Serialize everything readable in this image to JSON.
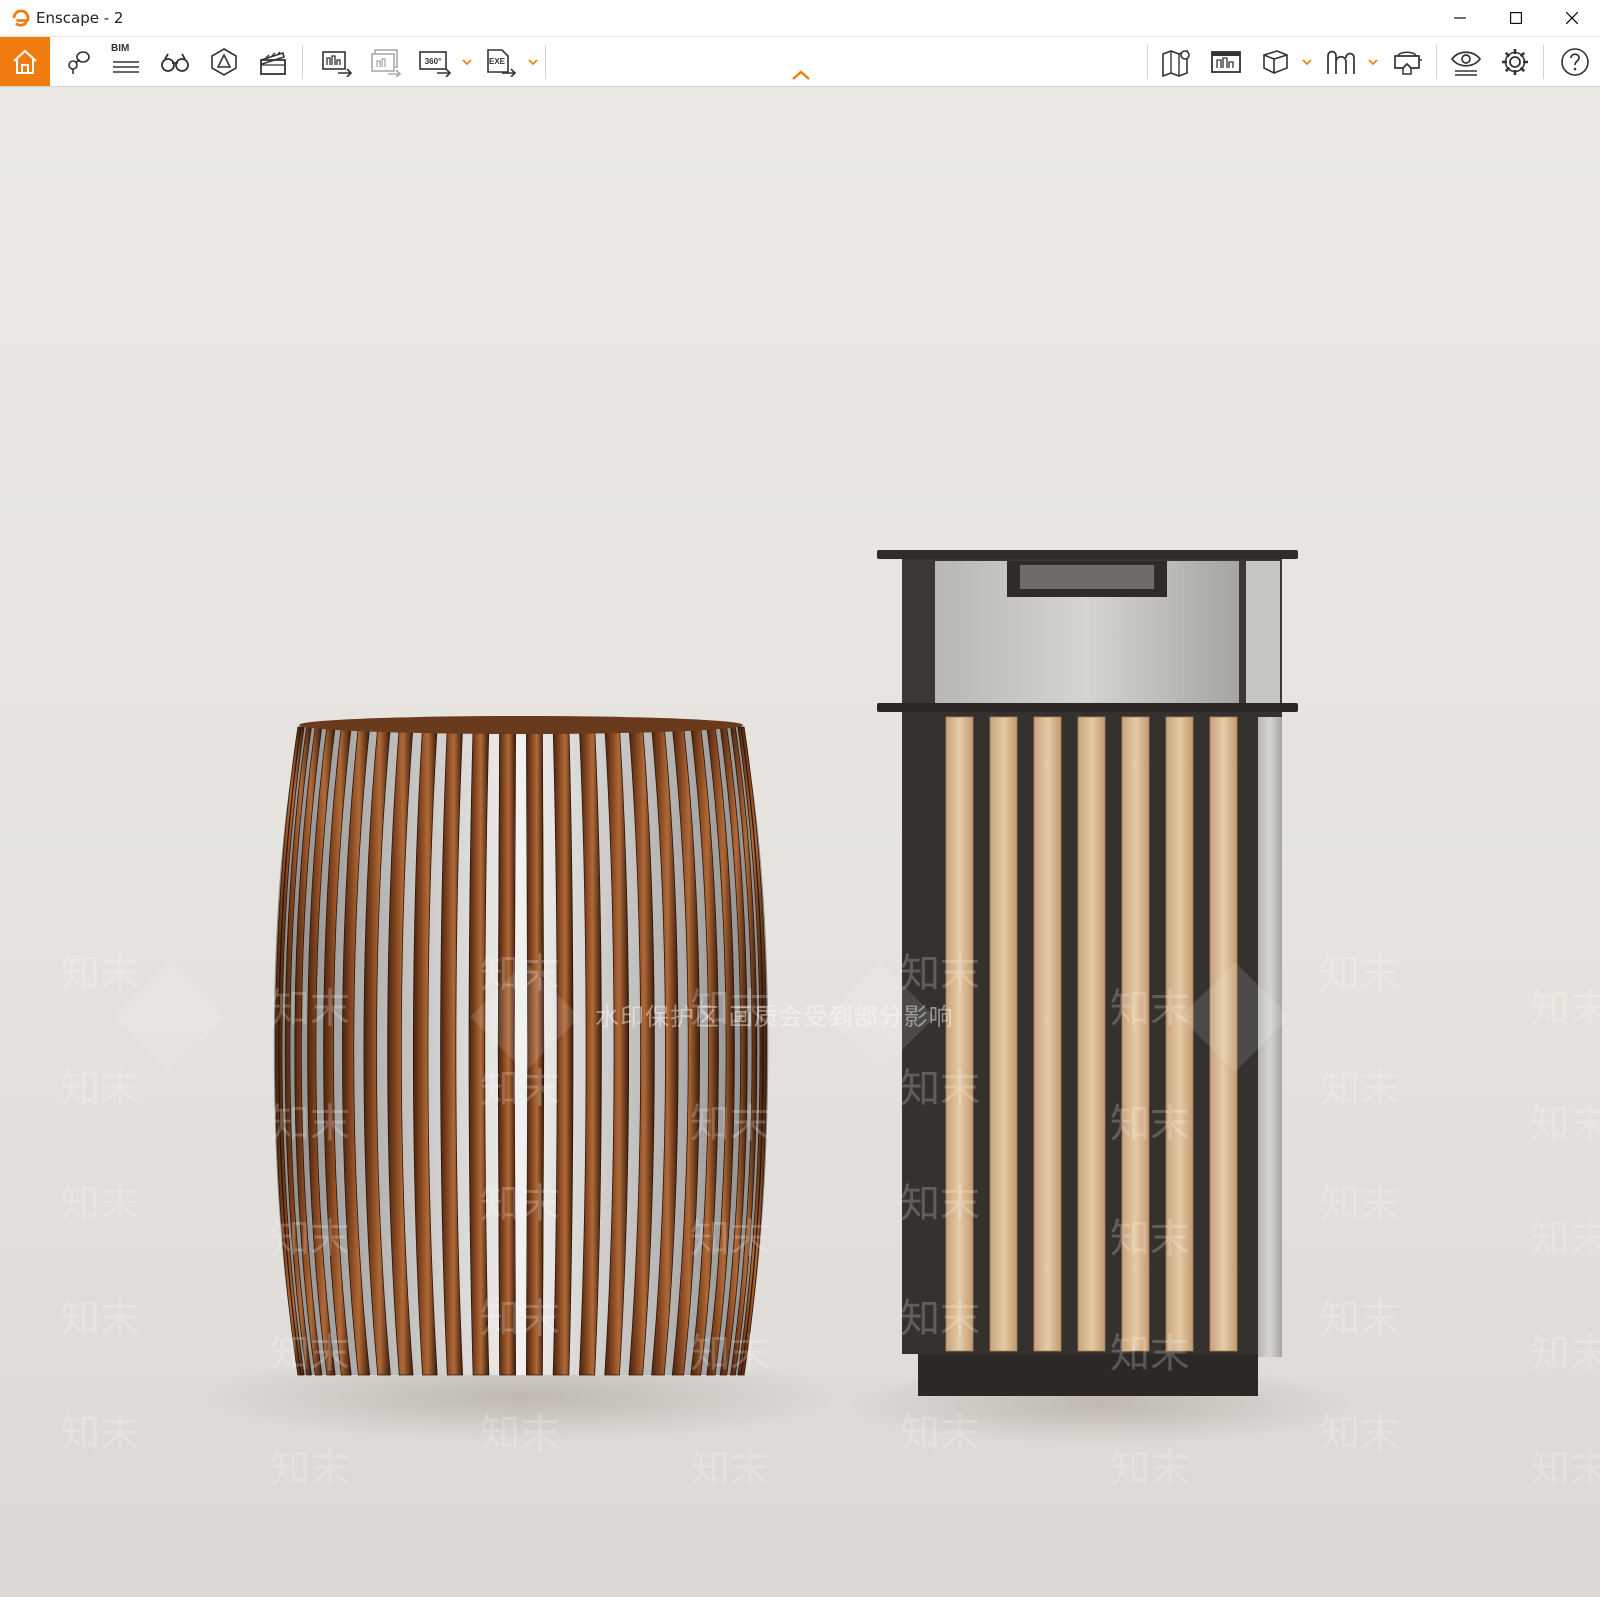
{
  "window": {
    "title": "Enscape - 2",
    "controls": [
      "minimize",
      "maximize",
      "close"
    ]
  },
  "toolbar": {
    "accent_color": "#f07c11",
    "left_buttons": [
      {
        "icon": "home-icon"
      },
      {
        "icon": "views-icon"
      },
      {
        "icon": "bim-icon",
        "label": "BIM"
      },
      {
        "icon": "binoculars-icon"
      },
      {
        "icon": "asset-library-icon"
      },
      {
        "icon": "video-editor-icon"
      },
      {
        "icon": "render-image-icon"
      },
      {
        "icon": "batch-render-icon"
      },
      {
        "icon": "panorama-export-icon",
        "label": "360°",
        "has_dropdown": true
      },
      {
        "icon": "exe-export-icon",
        "label": "EXE",
        "has_dropdown": true
      }
    ],
    "right_buttons": [
      {
        "icon": "map-icon"
      },
      {
        "icon": "material-editor-icon"
      },
      {
        "icon": "cube-icon",
        "has_dropdown": true
      },
      {
        "icon": "web-standalone-icon",
        "has_dropdown": true
      },
      {
        "icon": "vr-headset-icon"
      },
      {
        "icon": "visual-settings-icon"
      },
      {
        "icon": "settings-gear-icon"
      },
      {
        "icon": "help-icon"
      }
    ]
  },
  "viewport": {
    "watermark_text": "水印保护区  画质会受到部分影响",
    "watermark_tile": "知末"
  }
}
